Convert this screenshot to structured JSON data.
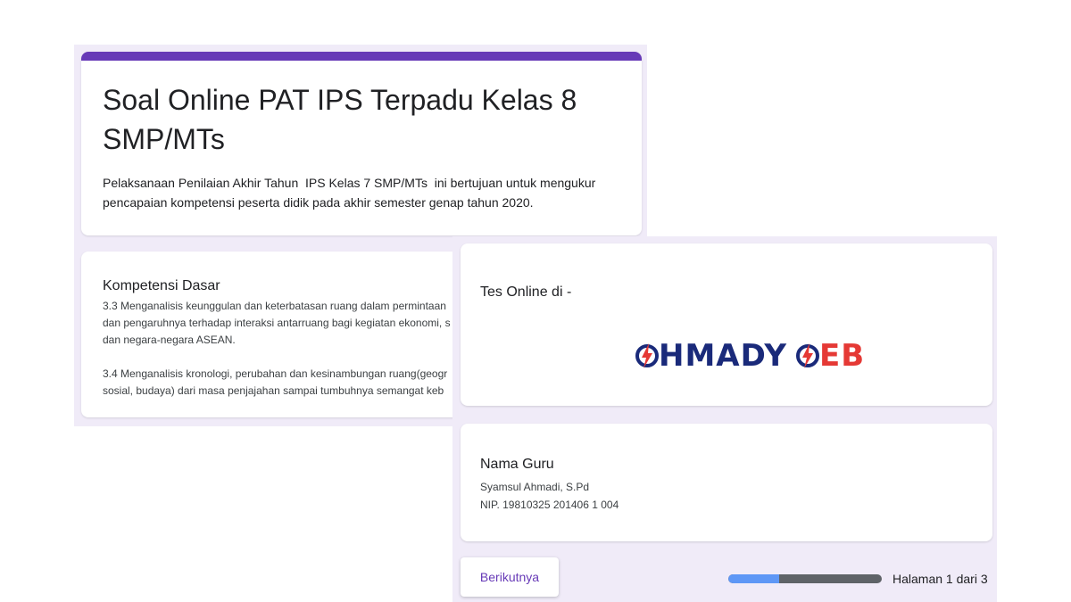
{
  "form": {
    "title_line1": "Soal Online PAT IPS Terpadu Kelas 8",
    "title_line2": "SMP/MTs",
    "description_line1": "Pelaksanaan Penilaian Akhir Tahun  IPS Kelas 7 SMP/MTs  ini bertujuan untuk mengukur",
    "description_line2": "pencapaian kompetensi peserta didik pada akhir semester genap tahun 2020.",
    "accent_color": "#673ab7"
  },
  "kompetensi": {
    "title": "Kompetensi Dasar",
    "kd1_line1": "3.3 Menganalisis keunggulan dan keterbatasan ruang dalam permintaan",
    "kd1_line2": "dan pengaruhnya terhadap interaksi antarruang bagi kegiatan ekonomi, s",
    "kd1_line3": "dan negara-negara ASEAN.",
    "kd2_line1": "3.4 Menganalisis kronologi, perubahan dan kesinambungan ruang(geogr",
    "kd2_line2": "sosial, budaya) dari masa penjajahan sampai tumbuhnya semangat keb"
  },
  "tes": {
    "label": "Tes Online di -",
    "logo_part1": "HMADY",
    "logo_part2": "EB",
    "logo_icon": "lightning-bolt-icon"
  },
  "guru": {
    "title": "Nama Guru",
    "name": "Syamsul Ahmadi, S.Pd",
    "nip": "NIP. 19810325 201406 1 004"
  },
  "navigation": {
    "next_label": "Berikutnya",
    "page_text": "Halaman 1 dari 3",
    "progress_fraction": 0.333
  }
}
